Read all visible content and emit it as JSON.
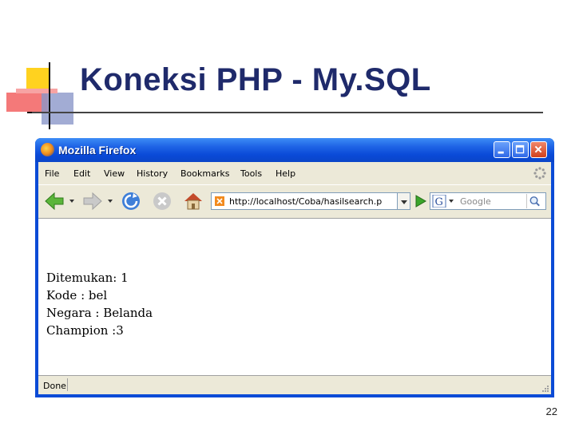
{
  "slide": {
    "title": "Koneksi PHP - My.SQL",
    "page_number": "22"
  },
  "window": {
    "title": "Mozilla Firefox",
    "controls": [
      "minimize-icon",
      "maximize-icon",
      "close-icon"
    ]
  },
  "menu": {
    "items": [
      "File",
      "Edit",
      "View",
      "History",
      "Bookmarks",
      "Tools",
      "Help"
    ]
  },
  "toolbar": {
    "url": "http://localhost/Coba/hasilsearch.p",
    "search_placeholder": "Google",
    "icons": [
      "back-icon",
      "forward-icon",
      "reload-icon",
      "stop-icon",
      "home-icon",
      "go-icon",
      "search-icon"
    ]
  },
  "page": {
    "lines": [
      "Ditemukan: 1",
      "Kode : bel",
      "Negara : Belanda",
      "Champion :3"
    ]
  },
  "status": {
    "text": "Done"
  },
  "colors": {
    "title": "#1f2a6b",
    "titlebar": "#0a4ad8",
    "chrome": "#ece9d8"
  }
}
